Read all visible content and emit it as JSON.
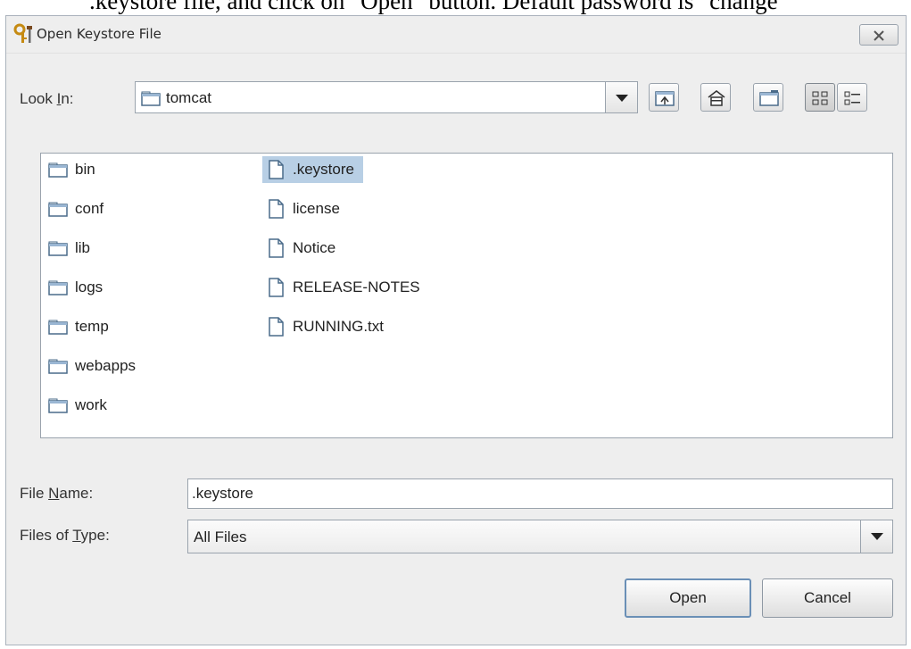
{
  "document": {
    "top_text": ".keystore file, and click on \"Open\" button. Default password is \"change"
  },
  "dialog": {
    "title": "Open Keystore File",
    "look_in": {
      "label_pre": "Look ",
      "label_mnemonic": "I",
      "label_post": "n:",
      "value": "tomcat"
    },
    "toolbar": [
      "up-one-level",
      "home",
      "new-folder",
      "list-view",
      "details-view"
    ],
    "files": [
      {
        "name": "bin",
        "type": "folder"
      },
      {
        "name": "conf",
        "type": "folder"
      },
      {
        "name": "lib",
        "type": "folder"
      },
      {
        "name": "logs",
        "type": "folder"
      },
      {
        "name": "temp",
        "type": "folder"
      },
      {
        "name": "webapps",
        "type": "folder"
      },
      {
        "name": "work",
        "type": "folder"
      },
      {
        "name": ".keystore",
        "type": "file",
        "selected": true
      },
      {
        "name": "license",
        "type": "file"
      },
      {
        "name": "Notice",
        "type": "file"
      },
      {
        "name": "RELEASE-NOTES",
        "type": "file"
      },
      {
        "name": "RUNNING.txt",
        "type": "file"
      }
    ],
    "file_name": {
      "label_pre": "File ",
      "label_mnemonic": "N",
      "label_post": "ame:",
      "value": ".keystore"
    },
    "files_of_type": {
      "label_pre": "Files of ",
      "label_mnemonic": "T",
      "label_post": "ype:",
      "value": "All Files"
    },
    "buttons": {
      "open": "Open",
      "cancel": "Cancel"
    }
  }
}
